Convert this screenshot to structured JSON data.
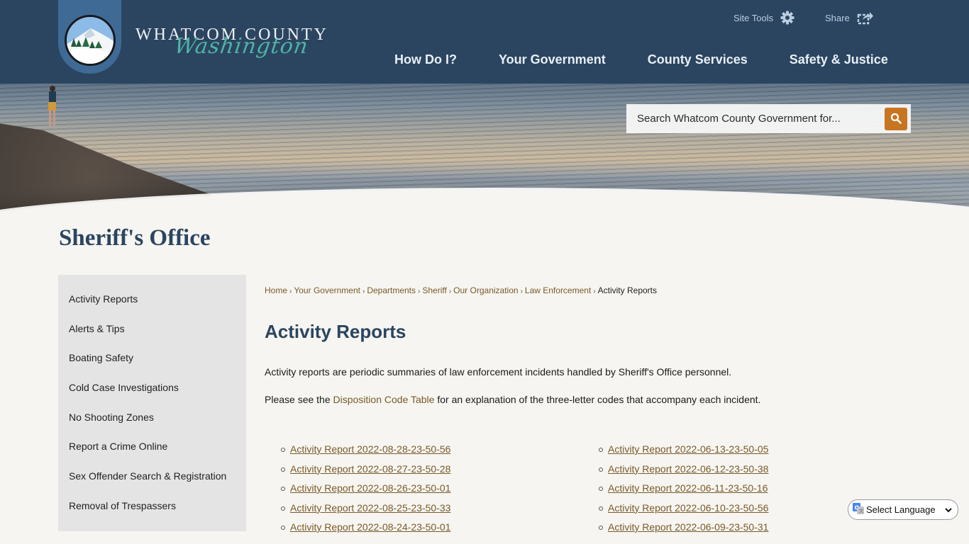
{
  "header": {
    "logo": {
      "line1": "WHATCOM COUNTY",
      "line2": "Washington",
      "icon": "county-seal-icon"
    },
    "utility": {
      "site_tools_label": "Site Tools",
      "site_tools_icon": "gear-icon",
      "share_label": "Share",
      "share_icon": "share-icon"
    },
    "nav": [
      {
        "label": "How Do I?"
      },
      {
        "label": "Your Government"
      },
      {
        "label": "County Services"
      },
      {
        "label": "Safety & Justice"
      }
    ],
    "search": {
      "placeholder": "Search Whatcom County Government for...",
      "value": "",
      "button_icon": "search-icon"
    }
  },
  "colors": {
    "header_bg": "#2b4560",
    "accent": "#c87522",
    "link": "#7a5a2a",
    "title": "#2b4560",
    "sidebar_bg": "#e4e4e4"
  },
  "department_title": "Sheriff's Office",
  "sidebar": {
    "items": [
      {
        "label": "Activity Reports"
      },
      {
        "label": "Alerts & Tips"
      },
      {
        "label": "Boating Safety"
      },
      {
        "label": "Cold Case Investigations"
      },
      {
        "label": "No Shooting Zones"
      },
      {
        "label": "Report a Crime Online"
      },
      {
        "label": "Sex Offender Search & Registration"
      },
      {
        "label": "Removal of Trespassers"
      }
    ]
  },
  "breadcrumb": {
    "items": [
      {
        "label": "Home"
      },
      {
        "label": "Your Government"
      },
      {
        "label": "Departments"
      },
      {
        "label": "Sheriff"
      },
      {
        "label": "Our Organization"
      },
      {
        "label": "Law Enforcement"
      }
    ],
    "current": "Activity Reports",
    "separator": "›"
  },
  "main": {
    "title": "Activity Reports",
    "intro": "Activity reports are periodic summaries of law enforcement incidents handled by Sheriff's Office personnel.",
    "disposition": {
      "before": "Please see the ",
      "link": "Disposition Code Table",
      "after": " for an explanation of the three-letter codes that accompany each incident."
    },
    "reports_left": [
      "Activity Report 2022-08-28-23-50-56",
      "Activity Report 2022-08-27-23-50-28",
      "Activity Report 2022-08-26-23-50-01",
      "Activity Report 2022-08-25-23-50-33",
      "Activity Report 2022-08-24-23-50-01"
    ],
    "reports_right": [
      "Activity Report 2022-06-13-23-50-05",
      "Activity Report 2022-06-12-23-50-38",
      "Activity Report 2022-06-11-23-50-16",
      "Activity Report 2022-06-10-23-50-56",
      "Activity Report 2022-06-09-23-50-31"
    ]
  },
  "translate": {
    "label": "Select Language",
    "icon": "google-translate-icon"
  }
}
